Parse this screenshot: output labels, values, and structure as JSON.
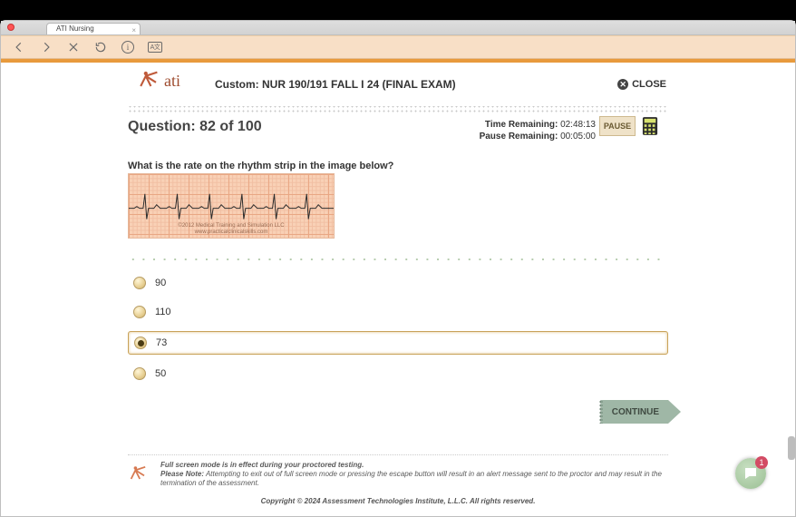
{
  "browser": {
    "tab_title": "ATI Nursing"
  },
  "header": {
    "logo_text": "ati",
    "exam_title": "Custom: NUR 190/191 FALL I 24 (FINAL EXAM)",
    "close_label": "CLOSE"
  },
  "question_bar": {
    "label_prefix": "Question:",
    "count": "82 of 100",
    "time_remaining_label": "Time Remaining:",
    "time_remaining_value": "02:48:13",
    "pause_remaining_label": "Pause Remaining:",
    "pause_remaining_value": "00:05:00",
    "pause_label": "PAUSE"
  },
  "question": {
    "text": "What is the rate on the rhythm strip in the image below?",
    "image_caption_line1": "©2012 Medical Training and Simulation LLC",
    "image_caption_line2": "www.practicalclinicalskills.com"
  },
  "answers": [
    {
      "label": "90",
      "selected": false
    },
    {
      "label": "110",
      "selected": false
    },
    {
      "label": "73",
      "selected": true
    },
    {
      "label": "50",
      "selected": false
    }
  ],
  "continue_label": "CONTINUE",
  "footer": {
    "line1": "Full screen mode is in effect during your proctored testing.",
    "line2": "Please Note: Attempting to exit out of full screen mode or pressing the escape button will result in an alert message sent to the proctor and may result in the termination of the assessment.",
    "copyright": "Copyright © 2024 Assessment Technologies Institute, L.L.C. All rights reserved."
  },
  "chat_badge": "1"
}
